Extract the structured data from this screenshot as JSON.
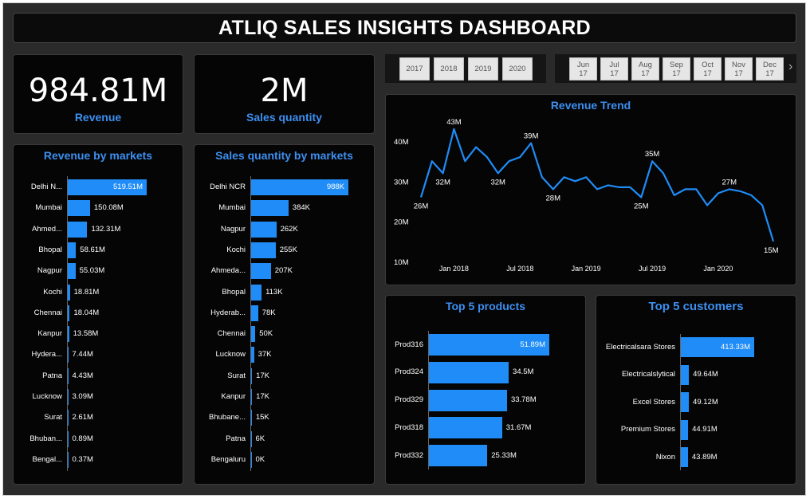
{
  "dashboard_title": "ATLIQ SALES INSIGHTS DASHBOARD",
  "kpis": [
    {
      "value": "984.81M",
      "label": "Revenue"
    },
    {
      "value": "2M",
      "label": "Sales quantity"
    }
  ],
  "year_slicer": [
    "2017",
    "2018",
    "2019",
    "2020"
  ],
  "month_slicer": [
    {
      "m": "Jun",
      "y": "17"
    },
    {
      "m": "Jul",
      "y": "17"
    },
    {
      "m": "Aug",
      "y": "17"
    },
    {
      "m": "Sep",
      "y": "17"
    },
    {
      "m": "Oct",
      "y": "17"
    },
    {
      "m": "Nov",
      "y": "17"
    },
    {
      "m": "Dec",
      "y": "17"
    }
  ],
  "slicer_next_icon": "chevron-right-icon",
  "accent_color": "#1f8cf7",
  "title_color": "#3d8ff0",
  "revenue_by_markets": {
    "title": "Revenue by markets",
    "rows": [
      {
        "label": "Delhi N...",
        "value": 519.51,
        "text": "519.51M"
      },
      {
        "label": "Mumbai",
        "value": 150.08,
        "text": "150.08M"
      },
      {
        "label": "Ahmed...",
        "value": 132.31,
        "text": "132.31M"
      },
      {
        "label": "Bhopal",
        "value": 58.61,
        "text": "58.61M"
      },
      {
        "label": "Nagpur",
        "value": 55.03,
        "text": "55.03M"
      },
      {
        "label": "Kochi",
        "value": 18.81,
        "text": "18.81M"
      },
      {
        "label": "Chennai",
        "value": 18.04,
        "text": "18.04M"
      },
      {
        "label": "Kanpur",
        "value": 13.58,
        "text": "13.58M"
      },
      {
        "label": "Hydera...",
        "value": 7.44,
        "text": "7.44M"
      },
      {
        "label": "Patna",
        "value": 4.43,
        "text": "4.43M"
      },
      {
        "label": "Lucknow",
        "value": 3.09,
        "text": "3.09M"
      },
      {
        "label": "Surat",
        "value": 2.61,
        "text": "2.61M"
      },
      {
        "label": "Bhuban...",
        "value": 0.89,
        "text": "0.89M"
      },
      {
        "label": "Bengal...",
        "value": 0.37,
        "text": "0.37M"
      }
    ]
  },
  "sales_qty_by_markets": {
    "title": "Sales quantity by markets",
    "rows": [
      {
        "label": "Delhi NCR",
        "value": 988,
        "text": "988K"
      },
      {
        "label": "Mumbai",
        "value": 384,
        "text": "384K"
      },
      {
        "label": "Nagpur",
        "value": 262,
        "text": "262K"
      },
      {
        "label": "Kochi",
        "value": 255,
        "text": "255K"
      },
      {
        "label": "Ahmeda...",
        "value": 207,
        "text": "207K"
      },
      {
        "label": "Bhopal",
        "value": 113,
        "text": "113K"
      },
      {
        "label": "Hyderab...",
        "value": 78,
        "text": "78K"
      },
      {
        "label": "Chennai",
        "value": 50,
        "text": "50K"
      },
      {
        "label": "Lucknow",
        "value": 37,
        "text": "37K"
      },
      {
        "label": "Surat",
        "value": 17,
        "text": "17K"
      },
      {
        "label": "Kanpur",
        "value": 17,
        "text": "17K"
      },
      {
        "label": "Bhubane...",
        "value": 15,
        "text": "15K"
      },
      {
        "label": "Patna",
        "value": 6,
        "text": "6K"
      },
      {
        "label": "Bengaluru",
        "value": 0,
        "text": "0K"
      }
    ]
  },
  "top_products": {
    "title": "Top 5 products",
    "rows": [
      {
        "label": "Prod316",
        "value": 51.89,
        "text": "51.89M"
      },
      {
        "label": "Prod324",
        "value": 34.5,
        "text": "34.5M"
      },
      {
        "label": "Prod329",
        "value": 33.78,
        "text": "33.78M"
      },
      {
        "label": "Prod318",
        "value": 31.67,
        "text": "31.67M"
      },
      {
        "label": "Prod332",
        "value": 25.33,
        "text": "25.33M"
      }
    ]
  },
  "top_customers": {
    "title": "Top 5 customers",
    "rows": [
      {
        "label": "Electricalsara Stores",
        "value": 413.33,
        "text": "413.33M"
      },
      {
        "label": "Electricalslytical",
        "value": 49.64,
        "text": "49.64M"
      },
      {
        "label": "Excel Stores",
        "value": 49.12,
        "text": "49.12M"
      },
      {
        "label": "Premium Stores",
        "value": 44.91,
        "text": "44.91M"
      },
      {
        "label": "Nixon",
        "value": 43.89,
        "text": "43.89M"
      }
    ]
  },
  "chart_data": {
    "type": "line",
    "title": "Revenue Trend",
    "xlabel": "",
    "ylabel": "",
    "x_ticks": [
      "Jan 2018",
      "Jul 2018",
      "Jan 2019",
      "Jul 2019",
      "Jan 2020"
    ],
    "y_ticks": [
      "40M",
      "30M",
      "20M",
      "10M"
    ],
    "ylim": [
      10,
      40
    ],
    "x": [
      "2017-10",
      "2017-11",
      "2017-12",
      "2018-01",
      "2018-02",
      "2018-03",
      "2018-04",
      "2018-05",
      "2018-06",
      "2018-07",
      "2018-08",
      "2018-09",
      "2018-10",
      "2018-11",
      "2018-12",
      "2019-01",
      "2019-02",
      "2019-03",
      "2019-04",
      "2019-05",
      "2019-06",
      "2019-07",
      "2019-08",
      "2019-09",
      "2019-10",
      "2019-11",
      "2019-12",
      "2020-01",
      "2020-02",
      "2020-03",
      "2020-04",
      "2020-05",
      "2020-06"
    ],
    "series": [
      {
        "values": [
          26,
          35,
          32,
          43,
          35,
          38.5,
          36,
          32,
          35,
          36,
          39.5,
          31,
          28,
          31,
          30,
          31,
          28,
          29,
          28.5,
          28.5,
          26,
          35,
          32,
          26.5,
          28,
          28,
          24,
          27,
          28,
          27.5,
          26.5,
          24,
          15
        ]
      }
    ],
    "data_labels": [
      {
        "i": 0,
        "text": "26M"
      },
      {
        "i": 2,
        "text": "32M"
      },
      {
        "i": 3,
        "text": "43M"
      },
      {
        "i": 7,
        "text": "32M"
      },
      {
        "i": 10,
        "text": "39M"
      },
      {
        "i": 12,
        "text": "28M"
      },
      {
        "i": 20,
        "text": "25M"
      },
      {
        "i": 21,
        "text": "35M"
      },
      {
        "i": 28,
        "text": "27M"
      },
      {
        "i": 32,
        "text": "15M"
      }
    ]
  }
}
